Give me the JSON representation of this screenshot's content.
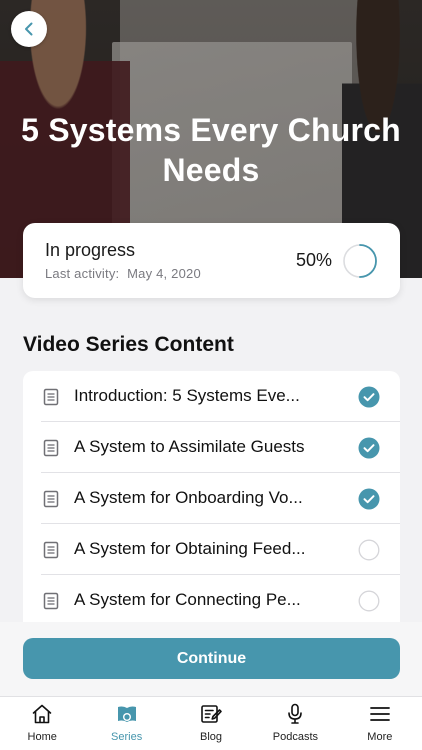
{
  "hero": {
    "title": "5 Systems Every Church Needs",
    "back_icon": "chevron-left-icon"
  },
  "progress": {
    "status": "In progress",
    "last_activity_label": "Last activity:",
    "last_activity_date": "May 4, 2020",
    "percent_text": "50%",
    "percent_value": 0.5
  },
  "section": {
    "title": "Video Series Content"
  },
  "items": [
    {
      "label": "Introduction: 5 Systems Eve...",
      "completed": true,
      "icon": "document-icon"
    },
    {
      "label": "A System to Assimilate Guests",
      "completed": true,
      "icon": "document-icon"
    },
    {
      "label": "A System for Onboarding Vo...",
      "completed": true,
      "icon": "document-icon"
    },
    {
      "label": "A System for Obtaining Feed...",
      "completed": false,
      "icon": "document-icon"
    },
    {
      "label": "A System for Connecting Pe...",
      "completed": false,
      "icon": "document-icon"
    }
  ],
  "actions": {
    "continue_label": "Continue"
  },
  "tabbar": {
    "tabs": [
      {
        "label": "Home",
        "icon": "home-icon",
        "active": false
      },
      {
        "label": "Series",
        "icon": "series-icon",
        "active": true
      },
      {
        "label": "Blog",
        "icon": "blog-icon",
        "active": false
      },
      {
        "label": "Podcasts",
        "icon": "microphone-icon",
        "active": false
      },
      {
        "label": "More",
        "icon": "menu-icon",
        "active": false
      }
    ]
  },
  "colors": {
    "accent": "#4796ad",
    "check_fill": "#4796ad",
    "background": "#f2f2f4"
  }
}
